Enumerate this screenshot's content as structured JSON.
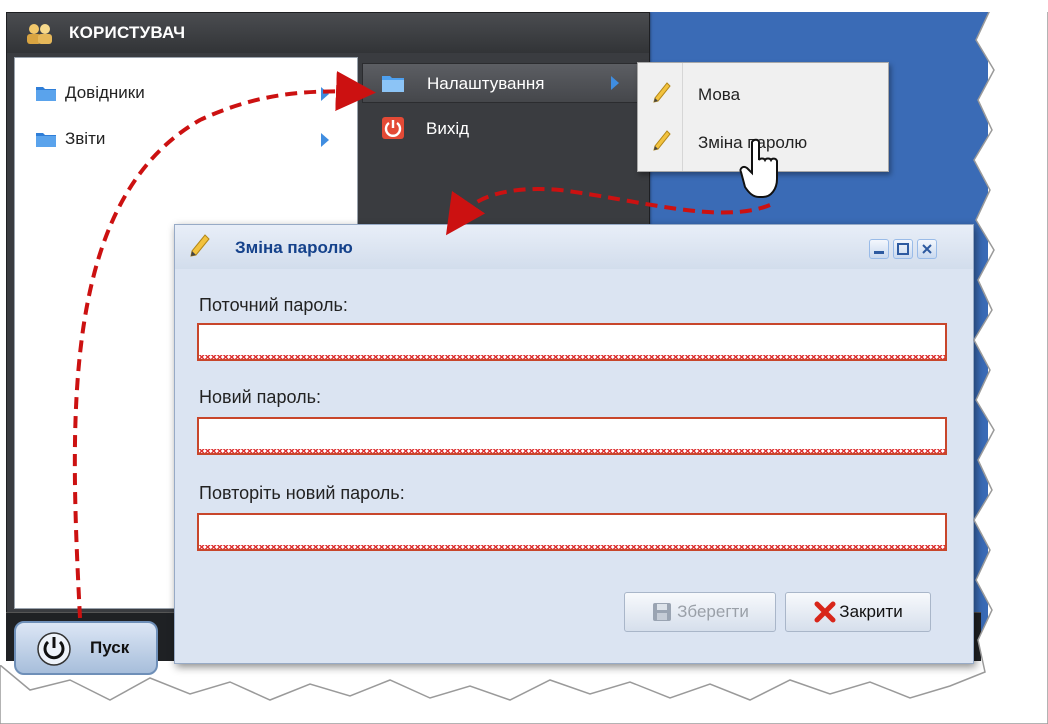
{
  "colors": {
    "desktop_blue": "#3a6bb6",
    "menu_dark": "#3a3c40",
    "dialog_bg": "#dbe4f2",
    "dialog_title": "#15428b",
    "error_border": "#c8462b",
    "annotation": "#cc1111"
  },
  "menu": {
    "title": "КОРИСТУВАЧ",
    "left_items": [
      {
        "label": "Довідники",
        "icon": "folder-icon"
      },
      {
        "label": "Звіти",
        "icon": "folder-icon"
      }
    ],
    "right_items": [
      {
        "label": "Налаштування",
        "icon": "folder-icon"
      },
      {
        "label": "Вихід",
        "icon": "power-icon"
      }
    ]
  },
  "submenu": {
    "items": [
      {
        "label": "Мова",
        "icon": "pencil-icon"
      },
      {
        "label": "Зміна паролю",
        "icon": "pencil-icon"
      }
    ]
  },
  "dialog": {
    "title": "Зміна паролю",
    "fields": [
      {
        "label": "Поточний пароль:",
        "value": ""
      },
      {
        "label": "Новий пароль:",
        "value": ""
      },
      {
        "label": "Повторіть новий пароль:",
        "value": ""
      }
    ],
    "save_label": "Зберегти",
    "close_label": "Закрити"
  },
  "taskbar": {
    "start_label": "Пуск"
  }
}
